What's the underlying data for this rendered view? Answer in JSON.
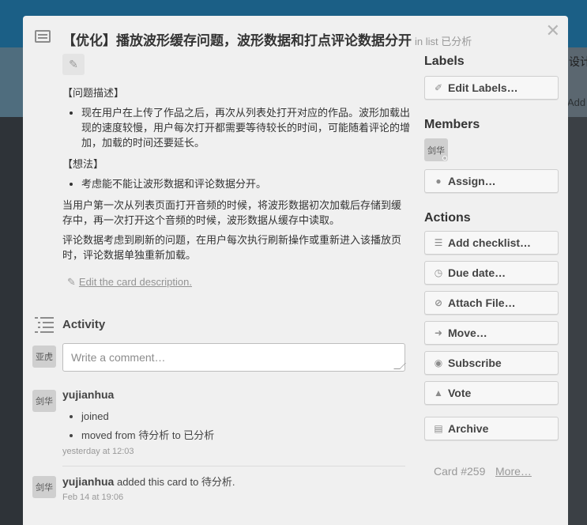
{
  "background": {
    "column_label": "设计",
    "add_label": "Add"
  },
  "card": {
    "title": "【优化】播放波形缓存问题，波形数据和打点评论数据分开",
    "in_list": "in list 已分析"
  },
  "description": {
    "problem_heading": "【问题描述】",
    "problem_item": "现在用户在上传了作品之后，再次从列表处打开对应的作品。波形加载出现的速度较慢，用户每次打开都需要等待较长的时间，可能随着评论的增加，加载的时间还要延长。",
    "idea_heading": "【想法】",
    "idea_item": "考虑能不能让波形数据和评论数据分开。",
    "para1": "当用户第一次从列表页面打开音频的时候，将波形数据初次加载后存储到缓存中，再一次打开这个音频的时候，波形数据从缓存中读取。",
    "para2": "评论数据考虑到刷新的问题，在用户每次执行刷新操作或重新进入该播放页时，评论数据单独重新加载。",
    "edit_link": "Edit the card description."
  },
  "activity": {
    "title": "Activity",
    "commenter_avatar": "亚虎",
    "comment_placeholder": "Write a comment…",
    "entries": [
      {
        "avatar": "剑华",
        "user": "yujianhua",
        "items": [
          "joined",
          "moved from 待分析 to 已分析"
        ],
        "time": "yesterday at 12:03"
      },
      {
        "avatar": "剑华",
        "user": "yujianhua",
        "text": " added this card to 待分析.",
        "time": "Feb 14 at 19:06"
      }
    ]
  },
  "sidebar": {
    "labels_heading": "Labels",
    "edit_labels": "Edit Labels…",
    "members_heading": "Members",
    "member_avatar": "剑华",
    "assign": "Assign…",
    "actions_heading": "Actions",
    "actions": {
      "add_checklist": "Add checklist…",
      "due_date": "Due date…",
      "attach_file": "Attach File…",
      "move": "Move…",
      "subscribe": "Subscribe",
      "vote": "Vote",
      "archive": "Archive"
    },
    "card_number": "Card #259",
    "more": "More…"
  }
}
